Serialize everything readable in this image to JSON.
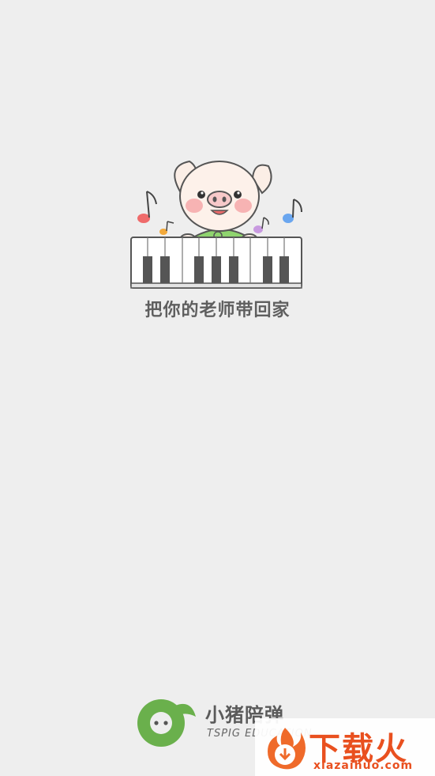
{
  "splash": {
    "tagline": "把你的老师带回家",
    "illustration": "pig-playing-piano-illustration"
  },
  "brand": {
    "name": "小猪陪弹",
    "subtitle": "TSPIG EDUCATION",
    "logo_icon": "music-note-pig-logo-icon",
    "color": "#6ab04c"
  },
  "watermark": {
    "title": "下载火",
    "url": "xiazaihuo.com",
    "icon": "fire-download-icon",
    "color": "#e9501f"
  }
}
